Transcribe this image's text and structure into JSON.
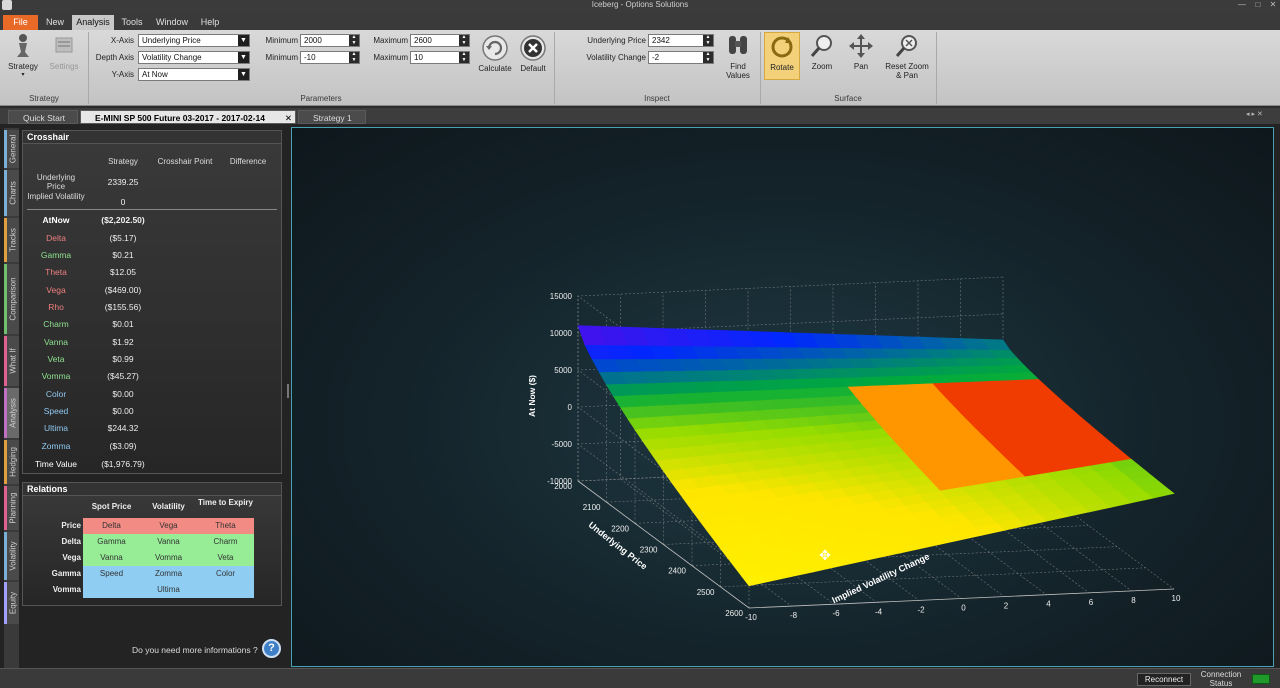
{
  "window": {
    "title": "Iceberg - Options Solutions",
    "minimize": "—",
    "maximize": "□",
    "close": "✕"
  },
  "menu": [
    "File",
    "New",
    "Analysis",
    "Tools",
    "Window",
    "Help"
  ],
  "ribbon": {
    "strategy_group": {
      "label": "Strategy",
      "strategy_button": "Strategy",
      "settings_button": "Settings"
    },
    "parameters": {
      "label": "Parameters",
      "x_axis_label": "X-Axis",
      "x_axis_value": "Underlying Price",
      "depth_axis_label": "Depth Axis",
      "depth_axis_value": "Volatility Change",
      "y_axis_label": "Y-Axis",
      "y_axis_value": "At Now",
      "min1_label": "Minimum",
      "min1_value": "2000",
      "max1_label": "Maximum",
      "max1_value": "2600",
      "min2_label": "Minimum",
      "min2_value": "-10",
      "max2_label": "Maximum",
      "max2_value": "10",
      "calculate": "Calculate",
      "default": "Default"
    },
    "inspect": {
      "label": "Inspect",
      "underlying_price_label": "Underlying Price",
      "underlying_price_value": "2342",
      "volatility_change_label": "Volatility Change",
      "volatility_change_value": "-2",
      "find_values": "Find Values"
    },
    "surface": {
      "label": "Surface",
      "rotate": "Rotate",
      "zoom": "Zoom",
      "pan": "Pan",
      "reset": "Reset Zoom & Pan"
    }
  },
  "tabs": [
    "Quick Start",
    "E-MINI SP 500 Future 03-2017 - 2017-02-14",
    "Strategy 1"
  ],
  "side_tabs": [
    "General",
    "Charts",
    "Tracks",
    "Comparison",
    "What If",
    "Analysis",
    "Hedging",
    "Planning",
    "Volatility",
    "Equity"
  ],
  "crosshair": {
    "title": "Crosshair",
    "headers": [
      "Strategy",
      "Crosshair Point",
      "Difference"
    ],
    "underlying_label": "Underlying Price",
    "underlying_value": "2339.25",
    "implied_label": "Implied Volatility",
    "implied_value": "0",
    "greeks": [
      {
        "name": "AtNow",
        "value": "($2,202.50)",
        "color": "#ffffff"
      },
      {
        "name": "Delta",
        "value": "($5.17)",
        "color": "#f07f7f"
      },
      {
        "name": "Gamma",
        "value": "$0.21",
        "color": "#8fe08f"
      },
      {
        "name": "Theta",
        "value": "$12.05",
        "color": "#f07f7f"
      },
      {
        "name": "Vega",
        "value": "($469.00)",
        "color": "#f07f7f"
      },
      {
        "name": "Rho",
        "value": "($155.56)",
        "color": "#f07f7f"
      },
      {
        "name": "Charm",
        "value": "$0.01",
        "color": "#8fe08f"
      },
      {
        "name": "Vanna",
        "value": "$1.92",
        "color": "#8fe08f"
      },
      {
        "name": "Veta",
        "value": "$0.99",
        "color": "#8fe08f"
      },
      {
        "name": "Vomma",
        "value": "($45.27)",
        "color": "#8fe08f"
      },
      {
        "name": "Color",
        "value": "$0.00",
        "color": "#8fc8f0"
      },
      {
        "name": "Speed",
        "value": "$0.00",
        "color": "#8fc8f0"
      },
      {
        "name": "Ultima",
        "value": "$244.32",
        "color": "#8fc8f0"
      },
      {
        "name": "Zomma",
        "value": "($3.09)",
        "color": "#8fc8f0"
      },
      {
        "name": "Time Value",
        "value": "($1,976.79)",
        "color": "#ffffff"
      }
    ]
  },
  "relations": {
    "title": "Relations",
    "col_headers": [
      "Spot Price",
      "Volatility",
      "Time to Expiry"
    ],
    "rows": [
      {
        "label": "Price",
        "cells": [
          "Delta",
          "Vega",
          "Theta"
        ],
        "color": "#f28b84"
      },
      {
        "label": "Delta",
        "cells": [
          "Gamma",
          "Vanna",
          "Charm"
        ],
        "color": "#96ed96"
      },
      {
        "label": "Vega",
        "cells": [
          "Vanna",
          "Vomma",
          "Veta"
        ],
        "color": "#96ed96"
      },
      {
        "label": "Gamma",
        "cells": [
          "Speed",
          "Zomma",
          "Color"
        ],
        "color": "#8fcdf2"
      },
      {
        "label": "Vomma",
        "cells": [
          "",
          "Ultima",
          ""
        ],
        "color": "#8fcdf2"
      }
    ]
  },
  "help": {
    "text": "Do you need more informations ?",
    "icon": "?"
  },
  "chart_data": {
    "type": "surface",
    "z_label": "At Now ($)",
    "x_label": "Underlying Price",
    "depth_label": "Implied Volatility Change",
    "z_ticks": [
      "15000",
      "10000",
      "5000",
      "0",
      "-5000",
      "-10000"
    ],
    "x_ticks": [
      "2000",
      "2100",
      "2200",
      "2300",
      "2400",
      "2500",
      "2600"
    ],
    "depth_ticks": [
      "-10",
      "-8",
      "-6",
      "-4",
      "-2",
      "0",
      "2",
      "4",
      "6",
      "8",
      "10"
    ],
    "x_range": [
      2000,
      2600
    ],
    "depth_range": [
      -10,
      10
    ],
    "z_range": [
      -10000,
      15000
    ]
  },
  "status": {
    "reconnect": "Reconnect",
    "connection": "Connection Status"
  }
}
